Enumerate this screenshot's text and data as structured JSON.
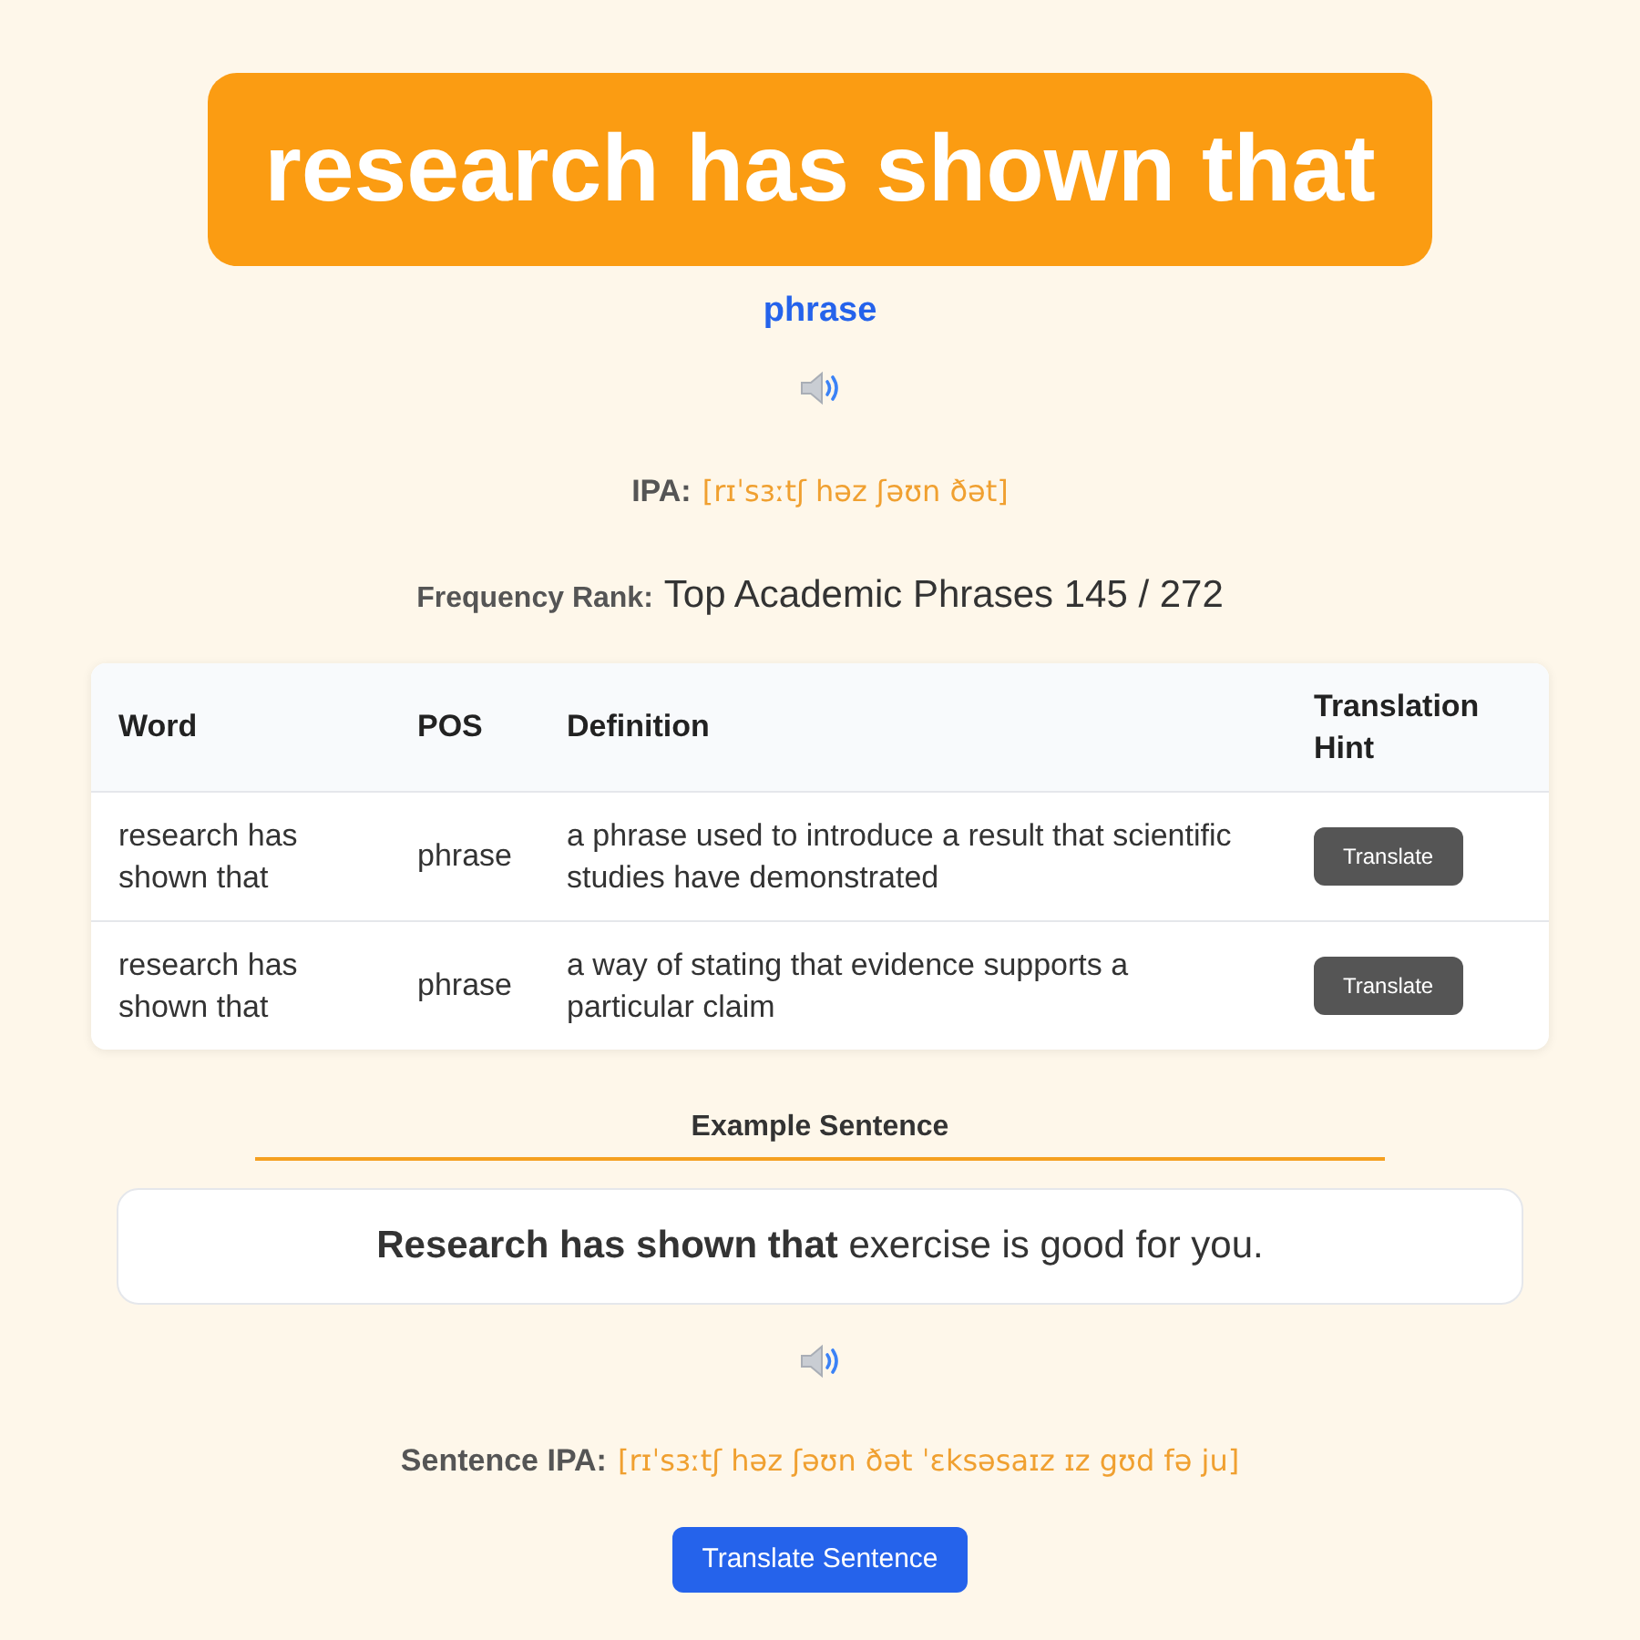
{
  "headword": "research has shown that",
  "part_of_speech": "phrase",
  "ipa": {
    "label": "IPA:",
    "value": "[rɪˈsɜːtʃ həz ʃəʊn ðət]"
  },
  "frequency_rank": {
    "label": "Frequency Rank:",
    "value": "Top Academic Phrases 145 / 272"
  },
  "table": {
    "columns": [
      "Word",
      "POS",
      "Definition",
      "Translation Hint"
    ],
    "rows": [
      {
        "word": "research has shown that",
        "pos": "phrase",
        "definition": "a phrase used to introduce a result that scientific studies have demonstrated",
        "button": "Translate"
      },
      {
        "word": "research has shown that",
        "pos": "phrase",
        "definition": "a way of stating that evidence supports a particular claim",
        "button": "Translate"
      }
    ]
  },
  "example": {
    "heading": "Example Sentence",
    "sentence": "**Research has shown that** exercise is good for you.",
    "ipa_label": "Sentence IPA:",
    "ipa_value": "[rɪˈsɜːtʃ həz ʃəʊn ðət ˈɛksəsaɪz ɪz gʊd fə ju]",
    "button": "Translate Sentence"
  }
}
